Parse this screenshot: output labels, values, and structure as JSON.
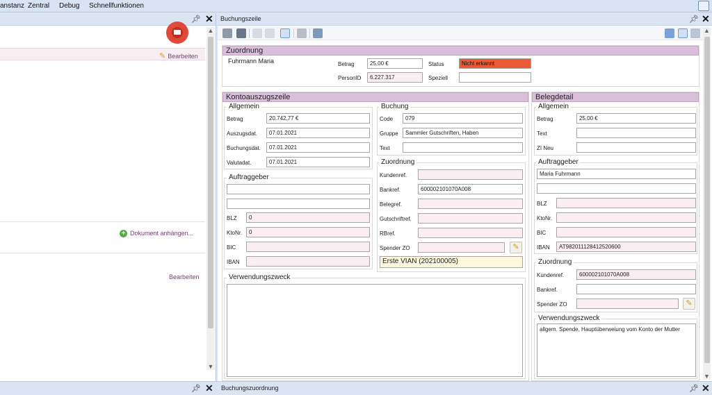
{
  "menu": {
    "items": [
      "anstanz",
      "Zentral",
      "Debug",
      "Schnellfunktionen"
    ]
  },
  "left_pane": {
    "edit_label_1": "Bearbeiten",
    "attach_label": "Dokument anhängen...",
    "edit_label_2": "Bearbeiten"
  },
  "right_pane": {
    "title": "Buchungszeile",
    "zuordnung": {
      "header": "Zuordnung",
      "name": "Fuhrmann Maria",
      "betrag_label": "Betrag",
      "betrag_value": "25,00 €",
      "status_label": "Status",
      "status_value": "Nicht erkannt",
      "personid_label": "PersonID",
      "personid_value": "6.227.317",
      "speziell_label": "Speziell",
      "speziell_value": ""
    },
    "kontoauszug": {
      "header": "Kontoauszugszeile",
      "allgemein_title": "Allgemein",
      "betrag_label": "Betrag",
      "betrag_value": "20.742,77 €",
      "auszugsdat_label": "Auszugsdat.",
      "auszugsdat_value": "07.01.2021",
      "buchungsdat_label": "Buchungsdat.",
      "buchungsdat_value": "07.01.2021",
      "valutadat_label": "Valutadat.",
      "valutadat_value": "07.01.2021",
      "auftraggeber_title": "Auftraggeber",
      "auftraggeber_line1": "",
      "auftraggeber_line2": "",
      "blz_label": "BLZ",
      "blz_value": "0",
      "ktonr_label": "KtoNr.",
      "ktonr_value": "0",
      "bic_label": "BIC",
      "bic_value": "",
      "iban_label": "IBAN",
      "iban_value": "",
      "buchung_title": "Buchung",
      "code_label": "Code",
      "code_value": "079",
      "gruppe_label": "Gruppe",
      "gruppe_value": "Sammler Gutschriften, Haben",
      "text_label": "Text",
      "text_value": "",
      "zuordnung_title": "Zuordnung",
      "kundenref_label": "Kundenref.",
      "kundenref_value": "",
      "bankref_label": "Bankref.",
      "bankref_value": "600002101070A008",
      "belegref_label": "Belegref.",
      "belegref_value": "",
      "gutschriftref_label": "Gutschriftref.",
      "gutschriftref_value": "",
      "rbref_label": "RBref.",
      "rbref_value": "",
      "spender_label": "Spender ZO",
      "spender_value": "",
      "vian_value": "Erste VIAN (202100005)",
      "verwendungszweck_title": "Verwendungszweck",
      "verwendungszweck_value": ""
    },
    "belegdetail": {
      "header": "Belegdetail",
      "allgemein_title": "Allgemein",
      "betrag_label": "Betrag",
      "betrag_value": "25,00 €",
      "text_label": "Text",
      "text_value": "",
      "zineu_label": "ZI Neu",
      "zineu_value": "",
      "auftraggeber_title": "Auftraggeber",
      "auftraggeber_line1": "Maria Fuhrmann",
      "auftraggeber_line2": "",
      "blz_label": "BLZ",
      "blz_value": "",
      "ktonr_label": "KtoNr.",
      "ktonr_value": "",
      "bic_label": "BIC",
      "bic_value": "",
      "iban_label": "IBAN",
      "iban_value": "AT982011128412520600",
      "zuordnung_title": "Zuordnung",
      "kundenref_label": "Kundenref.",
      "kundenref_value": "600002101070A008",
      "bankref_label": "Bankref.",
      "bankref_value": "",
      "spender_label": "Spender ZO",
      "spender_value": "",
      "verwendungszweck_title": "Verwendungszweck",
      "verwendungszweck_value": "allgem. Spende, Hauptüberweiung vom Konto der Mutter"
    }
  },
  "bottom": {
    "right_title": "Buchungszuordnung"
  }
}
